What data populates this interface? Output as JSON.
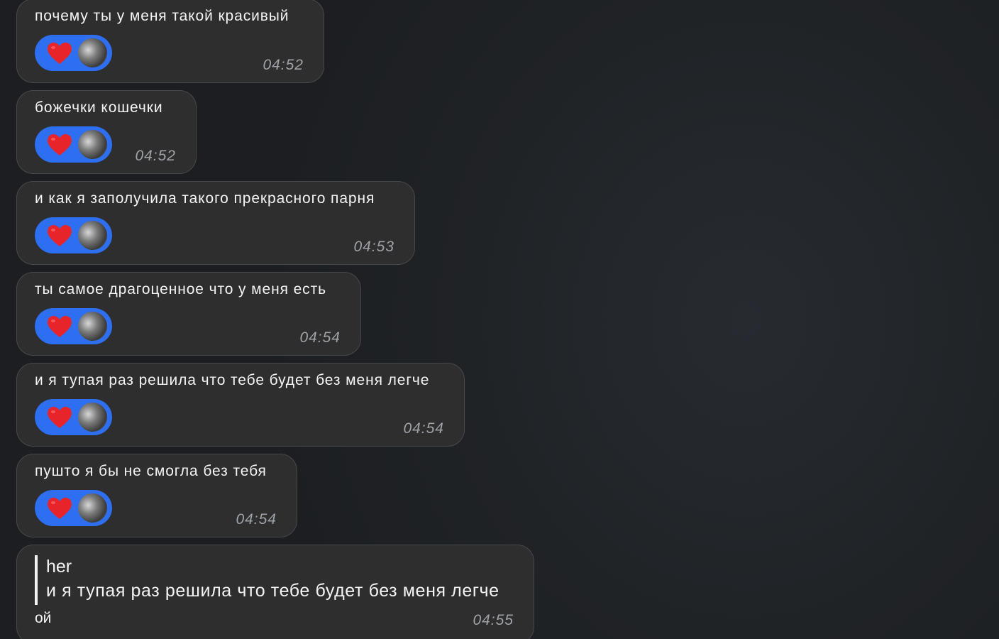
{
  "messages": [
    {
      "text": "почему ты у меня такой красивый",
      "time": "04:52",
      "reaction": "heart"
    },
    {
      "text": "божечки кошечки",
      "time": "04:52",
      "reaction": "heart"
    },
    {
      "text": "и как я заполучила такого прекрасного парня",
      "time": "04:53",
      "reaction": "heart"
    },
    {
      "text": "ты самое драгоценное что у меня есть",
      "time": "04:54",
      "reaction": "heart"
    },
    {
      "text": "и я тупая раз решила что тебе будет без меня легче",
      "time": "04:54",
      "reaction": "heart"
    },
    {
      "text": "пушто я бы не смогла без тебя",
      "time": "04:54",
      "reaction": "heart"
    }
  ],
  "reply_message": {
    "quote_author": "her",
    "quote_text": "и я тупая раз решила что тебе будет без меня легче",
    "text": "ой",
    "time": "04:55"
  },
  "colors": {
    "reaction_bg": "#2d6ff0",
    "heart": "#e8242b",
    "bubble_bg": "#2e2e2f",
    "timestamp": "#9fa3a8"
  }
}
